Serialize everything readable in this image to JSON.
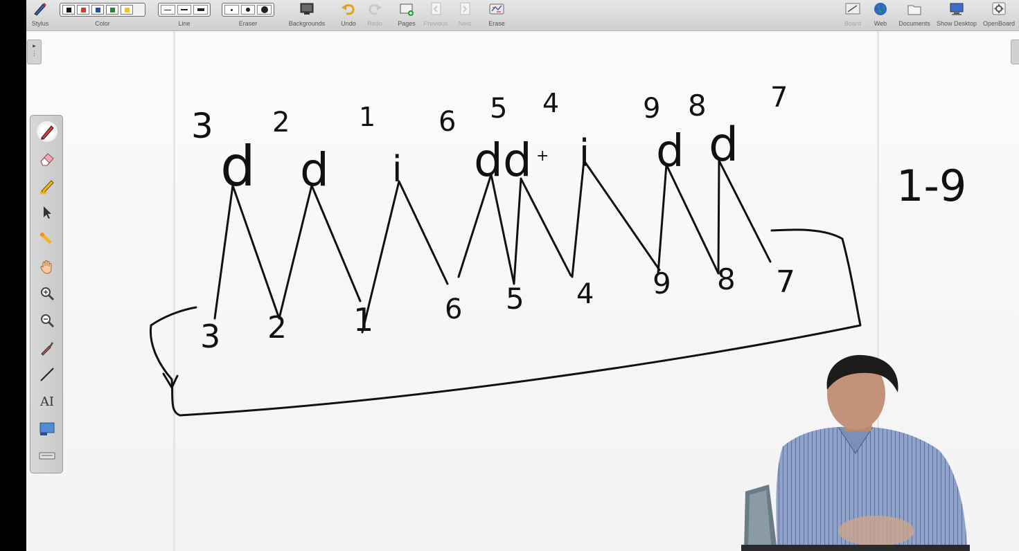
{
  "toolbar": {
    "stylus": "Stylus",
    "color": "Color",
    "line": "Line",
    "eraser": "Eraser",
    "backgrounds": "Backgrounds",
    "undo": "Undo",
    "redo": "Redo",
    "pages": "Pages",
    "previous": "Previous",
    "next": "Next",
    "erase": "Erase",
    "board": "Board",
    "web": "Web",
    "documents": "Documents",
    "show_desktop": "Show Desktop",
    "openboard": "OpenBoard",
    "colors": [
      "#111111",
      "#e8331e",
      "#1f4fa8",
      "#1d8a2c",
      "#f4c21b"
    ]
  },
  "side_tools": [
    "pen-icon",
    "eraser-icon",
    "highlighter-icon",
    "pointer-icon",
    "laser-pointer-icon",
    "hand-icon",
    "zoom-in-icon",
    "zoom-out-icon",
    "pipette-icon",
    "line-tool-icon",
    "text-tool-icon",
    "capture-icon",
    "keyboard-icon"
  ],
  "text_tool_label": "AI",
  "board": {
    "top_digits": [
      "3",
      "2",
      "1",
      "6",
      "5",
      "4",
      "9",
      "8",
      "7"
    ],
    "letters": [
      "d",
      "d",
      "i",
      "d",
      "d",
      "i",
      "d",
      "d"
    ],
    "plus_sign": "+",
    "bottom_digits": [
      "3",
      "2",
      "1",
      "6",
      "5",
      "4",
      "9",
      "8",
      "7"
    ],
    "range_note": "1-9"
  },
  "colors": {
    "ink": "#111111",
    "board_bg": "#f7f7f7",
    "toolbar_bg": "#d9d9d9"
  }
}
